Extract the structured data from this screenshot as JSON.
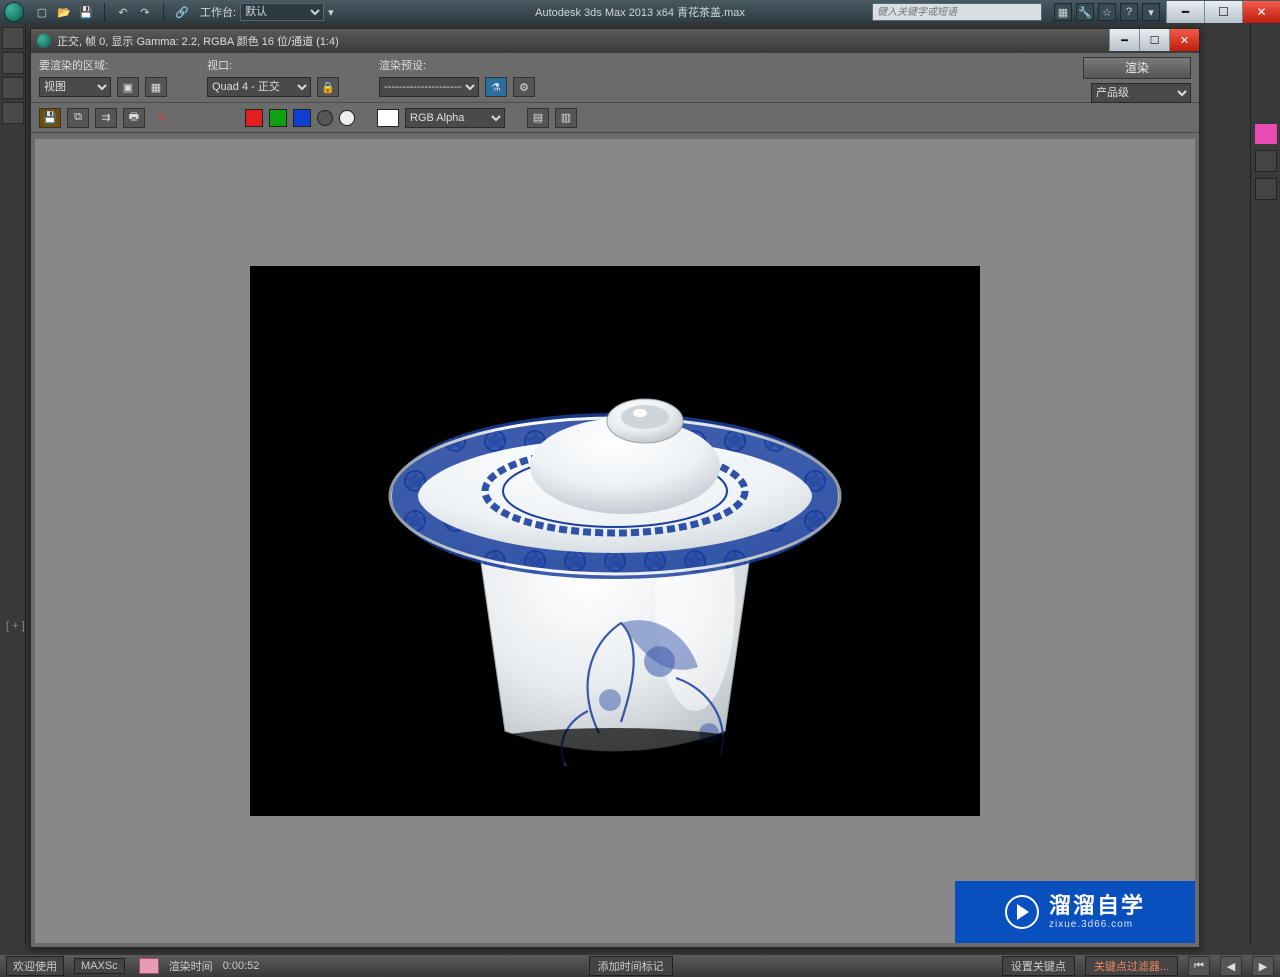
{
  "app": {
    "title_center": "Autodesk 3ds Max  2013 x64     青花茶盖.max",
    "workspace_label": "工作台:",
    "workspace_value": "默认",
    "search_placeholder": "键入关键字或短语"
  },
  "title_icons": {
    "new": "新建",
    "open": "打开",
    "save": "保存",
    "undo": "撤销",
    "redo": "重做",
    "link": "链接"
  },
  "render_window": {
    "title": "正交, 帧 0, 显示 Gamma: 2.2, RGBA 颜色 16 位/通道 (1:4)",
    "area_label": "要渲染的区域:",
    "area_value": "视图",
    "viewport_label": "视口:",
    "viewport_value": "Quad 4 - 正交",
    "preset_label": "渲染预设:",
    "preset_value": "--------------------------",
    "render_btn": "渲染",
    "production_value": "产品级",
    "channel_value": "RGB Alpha"
  },
  "statusbar": {
    "welcome": "欢迎使用",
    "maxscript": "MAXSc",
    "render_time_label": "渲染时间",
    "render_time_value": "0:00:52",
    "add_time_tag": "添加时间标记",
    "set_key": "设置关键点",
    "key_filters": "关键点过滤器..."
  },
  "vp_hint": "[ + ]",
  "watermark": {
    "big": "溜溜自学",
    "small": "zixue.3d66.com"
  }
}
